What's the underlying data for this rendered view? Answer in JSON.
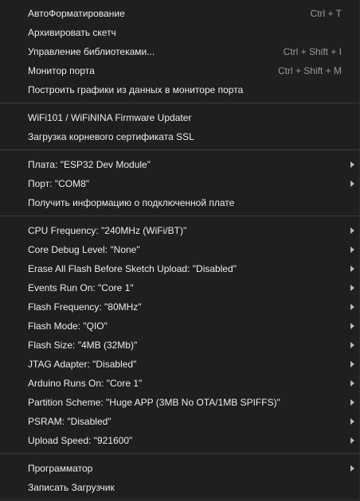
{
  "menu": {
    "group1": [
      {
        "label": "АвтоФорматирование",
        "shortcut": "Ctrl + T"
      },
      {
        "label": "Архивировать скетч",
        "shortcut": ""
      },
      {
        "label": "Управление библиотеками...",
        "shortcut": "Ctrl + Shift + I"
      },
      {
        "label": "Монитор порта",
        "shortcut": "Ctrl + Shift + M"
      },
      {
        "label": "Построить графики из данных в мониторе порта",
        "shortcut": ""
      }
    ],
    "group2": [
      {
        "label": "WiFi101 / WiFiNINA Firmware Updater"
      },
      {
        "label": "Загрузка корневого сертификата SSL"
      }
    ],
    "group3": [
      {
        "label": "Плата: \"ESP32 Dev Module\"",
        "submenu": true
      },
      {
        "label": "Порт: \"COM8\"",
        "submenu": true
      },
      {
        "label": "Получить информацию о подключенной плате",
        "submenu": false
      }
    ],
    "group4": [
      {
        "label": "CPU Frequency: \"240MHz (WiFi/BT)\""
      },
      {
        "label": "Core Debug Level: \"None\""
      },
      {
        "label": "Erase All Flash Before Sketch Upload: \"Disabled\""
      },
      {
        "label": "Events Run On: \"Core 1\""
      },
      {
        "label": "Flash Frequency: \"80MHz\""
      },
      {
        "label": "Flash Mode: \"QIO\""
      },
      {
        "label": "Flash Size: \"4MB (32Mb)\""
      },
      {
        "label": "JTAG Adapter: \"Disabled\""
      },
      {
        "label": "Arduino Runs On: \"Core 1\""
      },
      {
        "label": "Partition Scheme: \"Huge APP (3MB No OTA/1MB SPIFFS)\""
      },
      {
        "label": "PSRAM: \"Disabled\""
      },
      {
        "label": "Upload Speed: \"921600\""
      }
    ],
    "group5": [
      {
        "label": "Программатор",
        "submenu": true
      },
      {
        "label": "Записать Загрузчик",
        "submenu": false
      }
    ]
  },
  "colors": {
    "background": "#1f1f1f",
    "text": "#ececec",
    "shortcut": "#9a9a9a",
    "separator": "#3a3a3a"
  }
}
